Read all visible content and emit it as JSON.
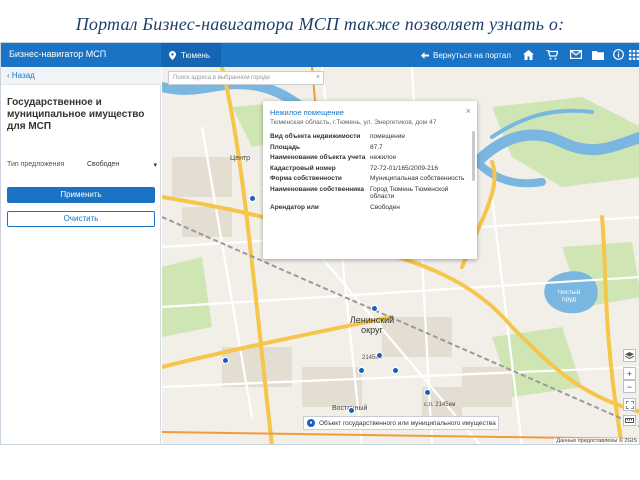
{
  "slide": {
    "title": "Портал Бизнес-навигатора МСП также позволяет узнать о:"
  },
  "topbar": {
    "app_name": "Бизнес-навигатор МСП",
    "city": "Тюмень",
    "back_label": "Вернуться на портал",
    "icons": [
      "home-icon",
      "cart-icon",
      "mail-icon",
      "folder-icon",
      "info-icon",
      "grid-icon"
    ]
  },
  "sidebar": {
    "back_label": "Назад",
    "heading": "Государственное и муниципальное имущество для МСП",
    "filter_label": "Тип предложения",
    "filter_value": "Свободен",
    "apply_label": "Применить",
    "clear_label": "Очистить"
  },
  "map": {
    "search_placeholder": "Поиск адреса в выбранном городе",
    "labels": {
      "center": "Центр",
      "district": "Ленинский округ",
      "lake": "Чистый пруд",
      "station": "Восточный",
      "km1": "2145км",
      "km2": "с.п. 2145км"
    },
    "popup": {
      "title": "Нежилое помещение",
      "address": "Тюменская область, г.Тюмень, ул. Энергетиков, дом 47",
      "rows": [
        {
          "key": "Вид объекта недвижимости",
          "value": "помещение"
        },
        {
          "key": "Площадь",
          "value": "87.7"
        },
        {
          "key": "Наименование объекта учета",
          "value": "нежилое"
        },
        {
          "key": "Кадастровый номер",
          "value": "72-72-01/165/2009-216"
        },
        {
          "key": "Форма собственности",
          "value": "Муниципальная собственность"
        },
        {
          "key": "Наименование собственника",
          "value": "Город Тюмень Тюменской области"
        },
        {
          "key": "Арендатор или",
          "value": "Свободен"
        }
      ]
    },
    "legend_text": "Объект государственного или муниципального имущества",
    "attribution": "Данные предоставлены © 2GIS",
    "controls": [
      "layers-icon",
      "zoom-in-icon",
      "zoom-out-icon",
      "fullscreen-icon",
      "ruler-icon"
    ]
  },
  "colors": {
    "primary": "#1a73c5",
    "river": "#79b7e0",
    "road": "#f6c64a",
    "marker": "#1a5fc0"
  }
}
